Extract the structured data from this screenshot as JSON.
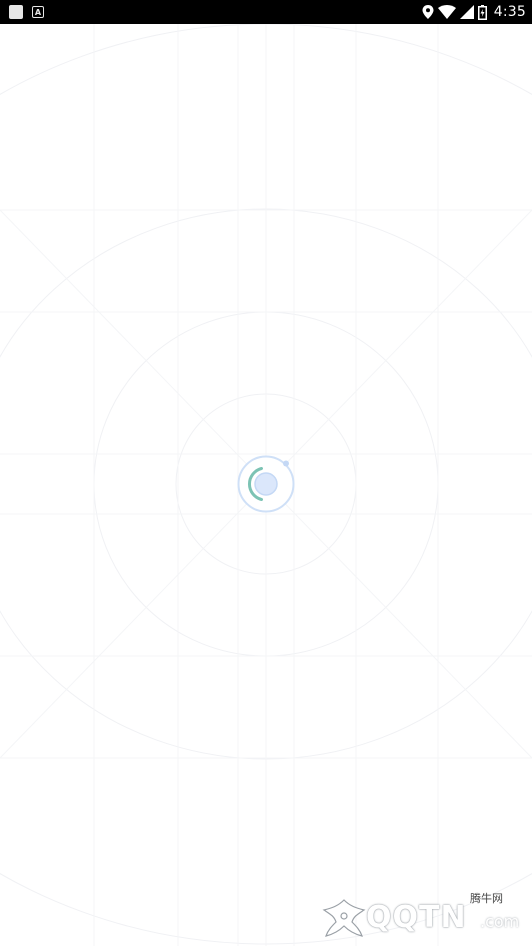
{
  "status_bar": {
    "time": "4:35",
    "left_icons": [
      "notification-square-icon",
      "a-notification-icon"
    ],
    "right_icons": [
      "location-icon",
      "wifi-icon",
      "signal-icon",
      "battery-icon"
    ]
  },
  "colors": {
    "status_bar_bg": "#000000",
    "background": "#ffffff",
    "ring_stroke": "#eef0f3",
    "loader_ring": "#cfe0f7",
    "loader_core": "#dbe7fb",
    "loader_arc": "#7cc3b4"
  },
  "watermark": {
    "brand": "QQTN",
    "domain_suffix": ".com",
    "cn_label": "腾牛网",
    "logo_icon": "bull-logo-icon"
  }
}
